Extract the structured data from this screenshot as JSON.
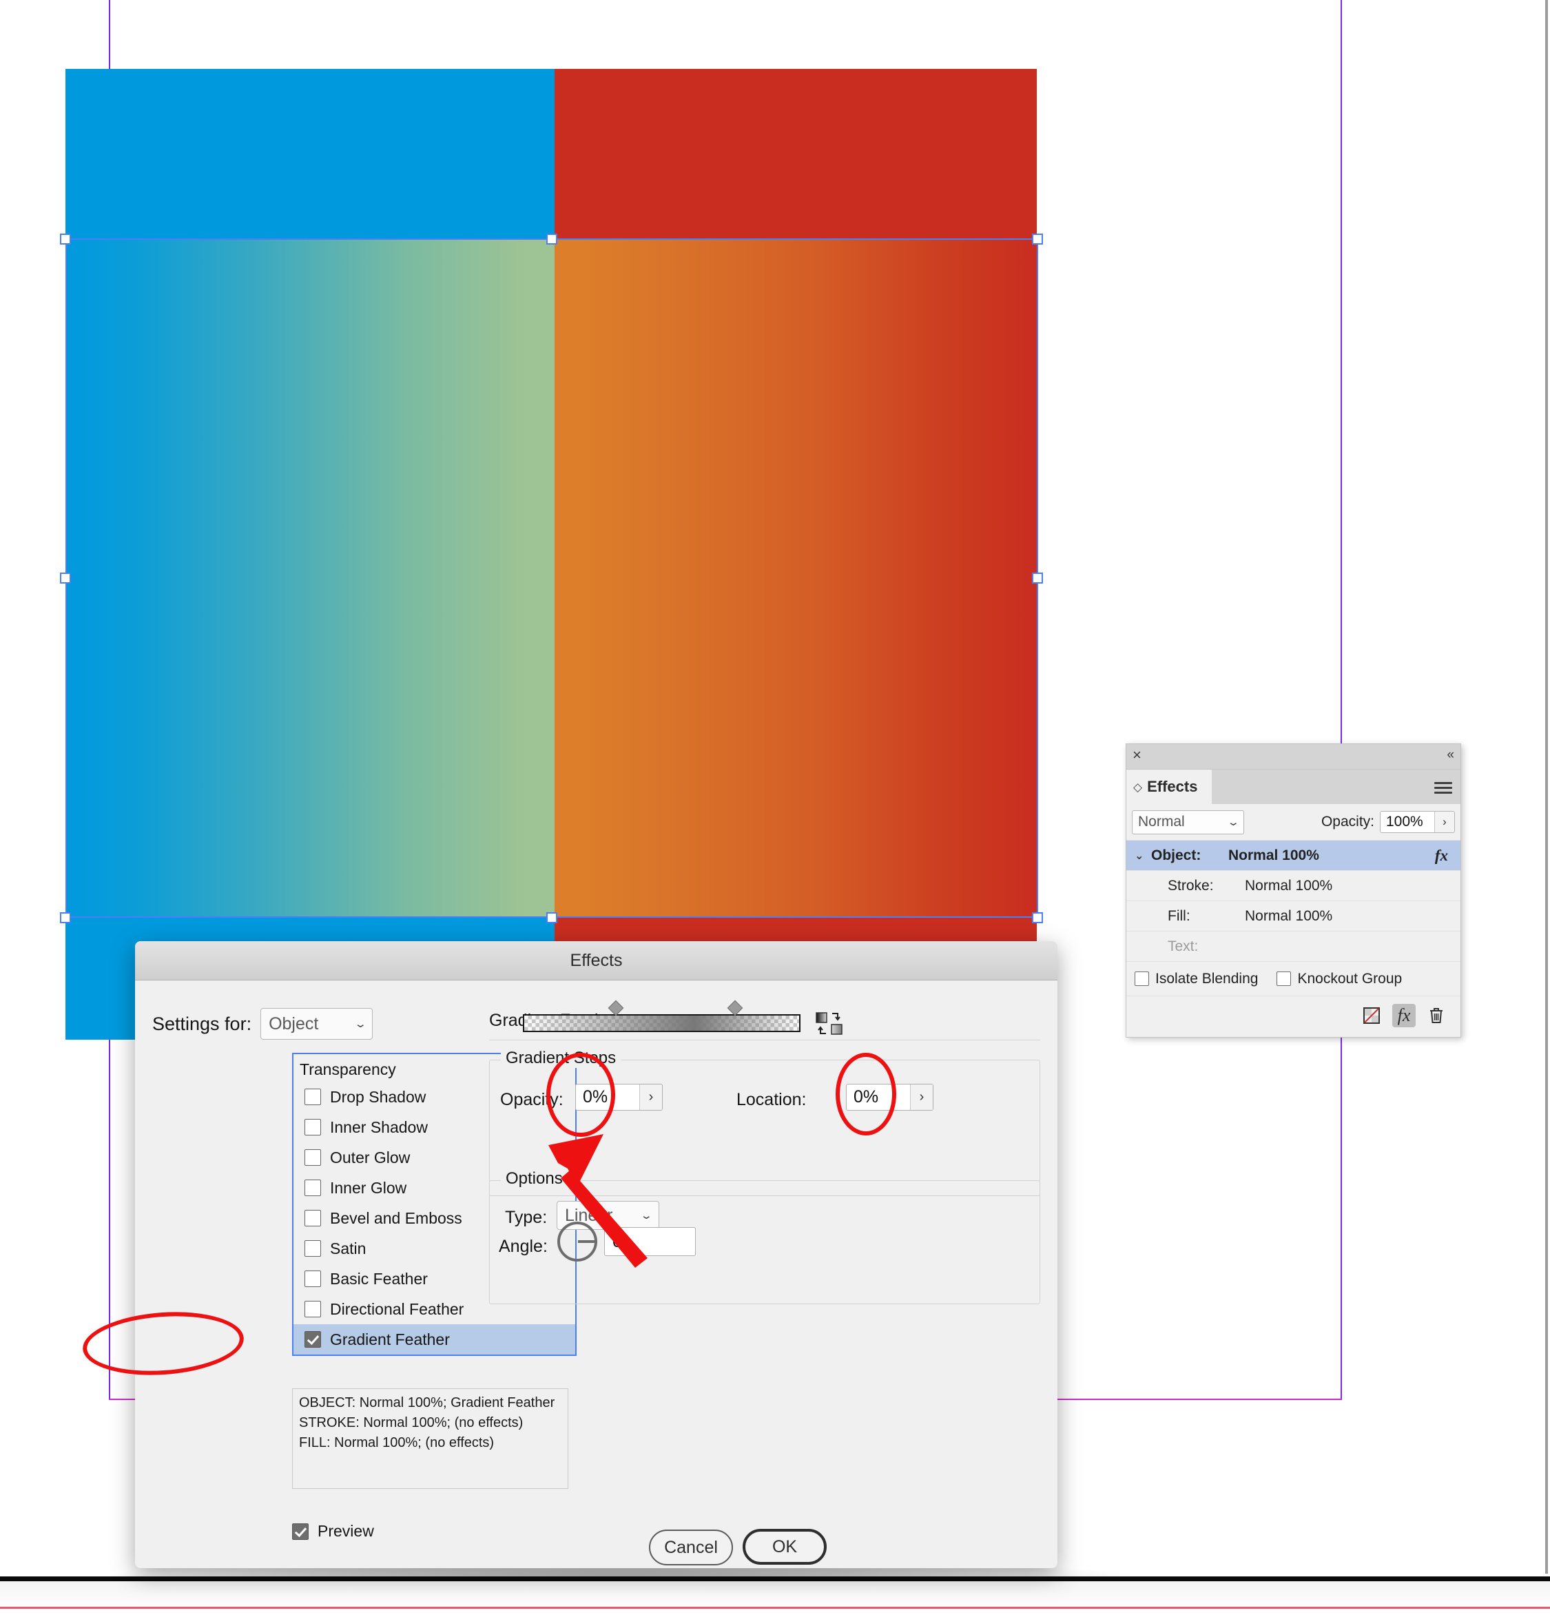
{
  "canvas": {
    "artwork": {
      "top_left_color": "#0099dd",
      "top_right_color": "#c92d20",
      "feather_left_from": "#0099dd",
      "feather_left_to": "#9ec394",
      "feather_right_from": "#dd7e2a",
      "feather_right_to": "#c92d20",
      "guide_color": "#7d2ae8",
      "margin_guide_color": "#cc29cc",
      "selection_color": "#4a7ff7"
    }
  },
  "effects_panel": {
    "title": "Effects",
    "close_icon": "×",
    "collapse_icon": "«",
    "menu_icon": "hamburger-icon",
    "blend_mode": "Normal",
    "opacity_label": "Opacity:",
    "opacity_value": "100%",
    "stepper_icon": "›",
    "rows": [
      {
        "key": "Object:",
        "value": "Normal 100%",
        "fx": "fx",
        "selected": true
      },
      {
        "key": "Stroke:",
        "value": "Normal 100%",
        "fx": "",
        "selected": false
      },
      {
        "key": "Fill:",
        "value": "Normal 100%",
        "fx": "",
        "selected": false
      },
      {
        "key": "Text:",
        "value": "",
        "fx": "",
        "selected": false
      }
    ],
    "isolate_blending": "Isolate Blending",
    "knockout_group": "Knockout Group",
    "tool_clear_icon": "clear-effects-icon",
    "tool_fx_icon": "fx",
    "tool_delete_icon": "trash-icon"
  },
  "dialog": {
    "title": "Effects",
    "settings_for_label": "Settings for:",
    "settings_for_value": "Object",
    "effects_list_header": "Transparency",
    "effects_list": [
      {
        "label": "Drop Shadow",
        "checked": false,
        "selected": false
      },
      {
        "label": "Inner Shadow",
        "checked": false,
        "selected": false
      },
      {
        "label": "Outer Glow",
        "checked": false,
        "selected": false
      },
      {
        "label": "Inner Glow",
        "checked": false,
        "selected": false
      },
      {
        "label": "Bevel and Emboss",
        "checked": false,
        "selected": false
      },
      {
        "label": "Satin",
        "checked": false,
        "selected": false
      },
      {
        "label": "Basic Feather",
        "checked": false,
        "selected": false
      },
      {
        "label": "Directional Feather",
        "checked": false,
        "selected": false
      },
      {
        "label": "Gradient Feather",
        "checked": true,
        "selected": true
      }
    ],
    "description": "OBJECT: Normal 100%; Gradient Feather\nSTROKE: Normal 100%; (no effects)\nFILL: Normal 100%; (no effects)",
    "preview_label": "Preview",
    "preview_checked": true,
    "panel_title": "Gradient Feather",
    "gradient_stops": {
      "legend": "Gradient Stops",
      "opacity_label": "Opacity:",
      "opacity_value": "0%",
      "location_label": "Location:",
      "location_value": "0%",
      "stepper_icon": "›",
      "reverse_icon": "reverse-gradient-icon"
    },
    "options": {
      "legend": "Options",
      "type_label": "Type:",
      "type_value": "Linear",
      "angle_label": "Angle:",
      "angle_value": "0°"
    },
    "buttons": {
      "cancel": "Cancel",
      "ok": "OK"
    }
  },
  "annotations": {
    "accent_color": "#ee1111",
    "arrow_target": "opacity-field",
    "circled": [
      "gradient-feather-list-item",
      "gradient-stop-left",
      "gradient-stop-right"
    ]
  }
}
